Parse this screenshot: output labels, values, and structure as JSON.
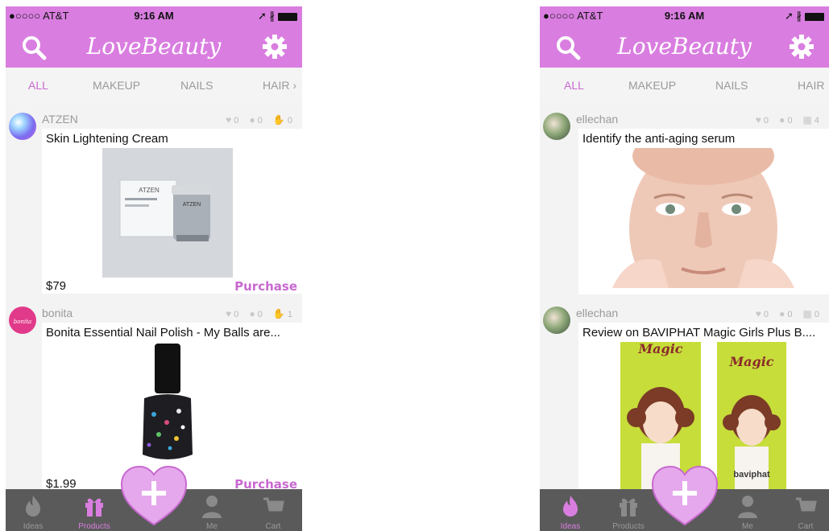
{
  "colors": {
    "accent": "#d97ee0",
    "accent_text": "#c869d0",
    "tabbar": "#5a5a5a",
    "muted": "#9a9a9a"
  },
  "status": {
    "carrier": "●○○○○ AT&T",
    "time": "9:16 AM"
  },
  "app_title": "LoveBeauty",
  "left": {
    "categories": [
      "ALL",
      "MAKEUP",
      "NAILS",
      "HAIR ›"
    ],
    "posts": [
      {
        "user": "ATZEN",
        "likes": "0",
        "comments": "0",
        "tries": "0",
        "title": "Skin Lightening Cream",
        "price": "$79",
        "action": "Purchase",
        "image": "cream-jar-product-photo"
      },
      {
        "user": "bonita",
        "likes": "0",
        "comments": "0",
        "tries": "1",
        "title": "Bonita Essential Nail Polish - My Balls are...",
        "price": "$1.99",
        "action": "Purchase",
        "image": "nail-polish-bottle-photo"
      }
    ],
    "tabs": [
      "Ideas",
      "Products",
      "Me",
      "Cart"
    ],
    "active_tab": "Products"
  },
  "right": {
    "categories": [
      "ALL",
      "MAKEUP",
      "NAILS",
      "HAIR"
    ],
    "posts": [
      {
        "user": "ellechan",
        "likes": "0",
        "comments": "0",
        "saves": "4",
        "title": "Identify the anti-aging serum",
        "image": "anti-aging-face-photo"
      },
      {
        "user": "ellechan",
        "likes": "0",
        "comments": "0",
        "saves": "0",
        "title": "Review on BAVIPHAT Magic Girls Plus B....",
        "image": "magic-girls-tubes-photo"
      }
    ],
    "tabs": [
      "Ideas",
      "Products",
      "Me",
      "Cart"
    ],
    "active_tab": "Ideas"
  }
}
